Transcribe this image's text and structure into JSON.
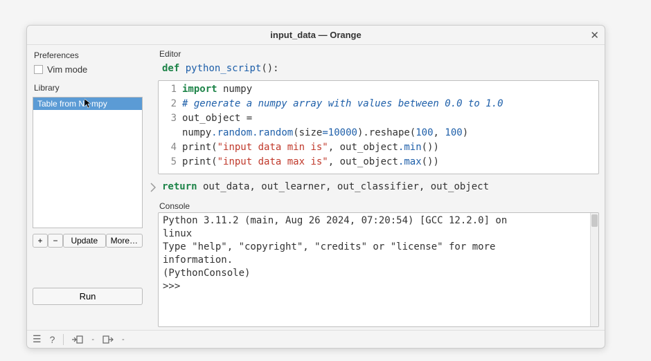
{
  "window": {
    "title": "input_data — Orange"
  },
  "left": {
    "preferences_label": "Preferences",
    "vim_mode_label": "Vim mode",
    "library_label": "Library",
    "library_items": [
      "Table from Numpy"
    ],
    "add_btn": "+",
    "remove_btn": "−",
    "update_btn": "Update",
    "more_btn": "More…",
    "run_btn": "Run"
  },
  "editor": {
    "label": "Editor",
    "sig_def": "def",
    "sig_name": "python_script",
    "sig_tail": "():",
    "lines": {
      "l1_kw": "import",
      "l1_mod": " numpy",
      "l2_cmt": "# generate a numpy array with values between 0.0 to 1.0",
      "l3_txt": "out_object =",
      "l3b_a": "numpy",
      "l3b_b": ".random",
      "l3b_c": ".random",
      "l3b_d": "(size",
      "l3b_e": "=",
      "l3b_num1": "10000",
      "l3b_f": ").reshape(",
      "l3b_num2": "100",
      "l3b_g": ", ",
      "l3b_num3": "100",
      "l3b_h": ")",
      "l4_a": "print",
      "l4_b": "(",
      "l4_str": "\"input data min is\"",
      "l4_c": ", out_object",
      "l4_d": ".min",
      "l4_e": "())",
      "l5_a": "print",
      "l5_b": "(",
      "l5_str": "\"input data max is\"",
      "l5_c": ", out_object",
      "l5_d": ".max",
      "l5_e": "())"
    },
    "ret_kw": "return",
    "ret_tail": " out_data, out_learner, out_classifier, out_object"
  },
  "console": {
    "label": "Console",
    "l1": "Python 3.11.2 (main, Aug 26 2024, 07:20:54) [GCC 12.2.0] on",
    "l2": "linux",
    "l3": "Type \"help\", \"copyright\", \"credits\" or \"license\" for more",
    "l4": "information.",
    "l5": "(PythonConsole)",
    "l6": ">>>"
  }
}
